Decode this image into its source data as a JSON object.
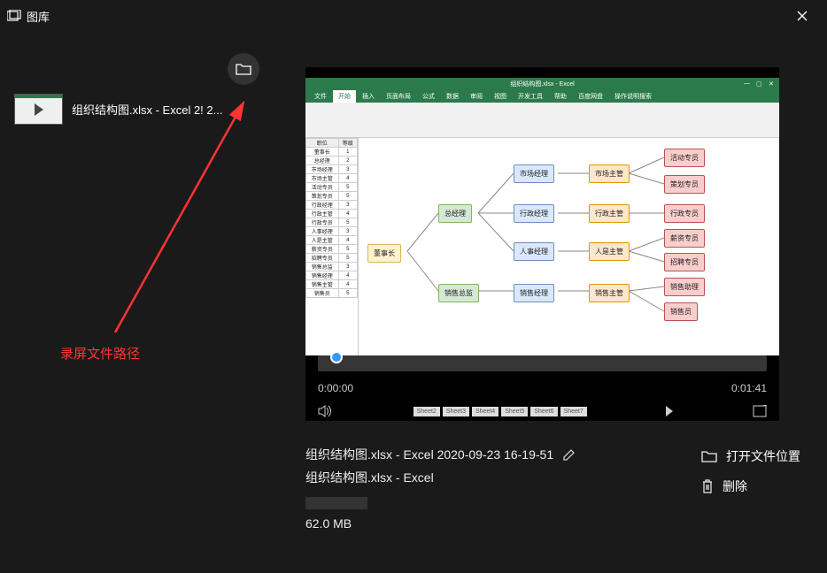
{
  "titlebar": {
    "title": "图库"
  },
  "sidebar": {
    "thumb_label": "组织结构图.xlsx - Excel 2! 2...",
    "annotation": "录屏文件路径"
  },
  "video": {
    "current_time": "0:00:00",
    "total_time": "0:01:41",
    "excel_title": "组织结构图.xlsx - Excel",
    "tabs": [
      "文件",
      "开始",
      "插入",
      "页面布局",
      "公式",
      "数据",
      "审阅",
      "视图",
      "开发工具",
      "帮助",
      "百度网盘",
      "操作说明搜索"
    ],
    "sheets": [
      "Sheet2",
      "Sheet3",
      "Sheet4",
      "Sheet5",
      "Sheet6",
      "Sheet7"
    ],
    "table_header": [
      "职位",
      "等级"
    ],
    "table_rows": [
      [
        "董事长",
        "1"
      ],
      [
        "总经理",
        "2"
      ],
      [
        "市场经理",
        "3"
      ],
      [
        "市场主管",
        "4"
      ],
      [
        "活动专员",
        "5"
      ],
      [
        "策划专员",
        "5"
      ],
      [
        "行政经理",
        "3"
      ],
      [
        "行政主管",
        "4"
      ],
      [
        "行政专员",
        "5"
      ],
      [
        "人事经理",
        "3"
      ],
      [
        "人是主管",
        "4"
      ],
      [
        "薪资专员",
        "5"
      ],
      [
        "招聘专员",
        "5"
      ],
      [
        "销售总监",
        "3"
      ],
      [
        "销售经理",
        "4"
      ],
      [
        "销售主管",
        "4"
      ],
      [
        "销售员",
        "5"
      ]
    ],
    "nodes": {
      "root": "董事长",
      "gm": "总经理",
      "mkt_mgr": "市场经理",
      "mkt_sup": "市场主管",
      "act": "活动专员",
      "plan": "策划专员",
      "adm_mgr": "行政经理",
      "adm_sup": "行政主管",
      "adm_sp": "行政专员",
      "hr_mgr": "人事经理",
      "hr_sup": "人是主管",
      "sal_sp": "薪资专员",
      "rec_sp": "招聘专员",
      "sales_dir": "销售总监",
      "sales_mgr": "销售经理",
      "sales_sup": "销售主管",
      "sales_ass": "销售助理",
      "sales_emp": "销售员"
    }
  },
  "file": {
    "name": "组织结构图.xlsx - Excel 2020-09-23 16-19-51",
    "subtitle": "组织结构图.xlsx - Excel",
    "size": "62.0 MB"
  },
  "actions": {
    "open_location": "打开文件位置",
    "delete": "删除"
  }
}
